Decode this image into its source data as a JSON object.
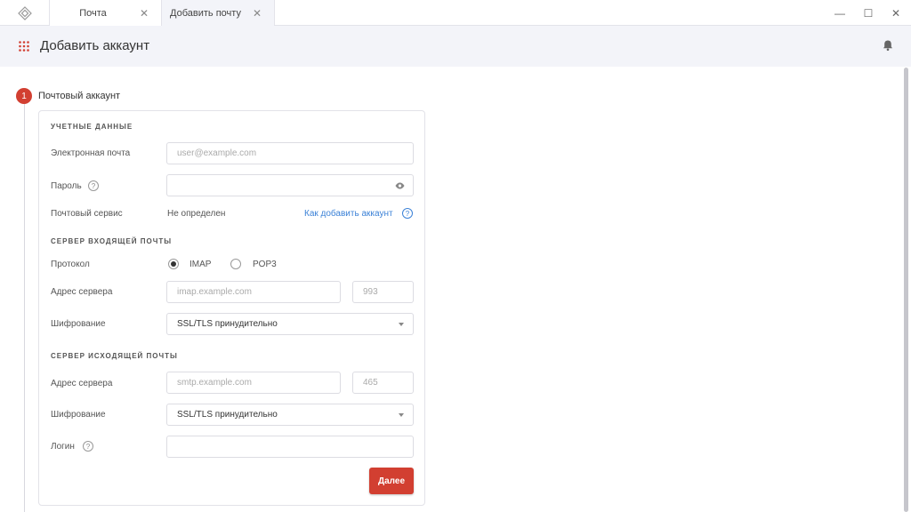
{
  "tabs": [
    {
      "label": "Почта",
      "close": "✕"
    },
    {
      "label": "Добавить почту",
      "close": "✕"
    }
  ],
  "window_controls": {
    "minimize": "—",
    "maximize": "☐",
    "close": "✕"
  },
  "header": {
    "title": "Добавить аккаунт"
  },
  "step": {
    "number": "1",
    "title": "Почтовый аккаунт"
  },
  "credentials": {
    "section_title": "УЧЕТНЫЕ ДАННЫЕ",
    "email_label": "Электронная почта",
    "email_placeholder": "user@example.com",
    "password_label": "Пароль",
    "password_value": "",
    "service_label": "Почтовый сервис",
    "service_value": "Не определен",
    "help_link": "Как добавить аккаунт"
  },
  "incoming": {
    "section_title": "СЕРВЕР ВХОДЯЩЕЙ ПОЧТЫ",
    "protocol_label": "Протокол",
    "protocol_options": [
      "IMAP",
      "POP3"
    ],
    "protocol_selected": "IMAP",
    "server_label": "Адрес сервера",
    "server_placeholder": "imap.example.com",
    "port_placeholder": "993",
    "encryption_label": "Шифрование",
    "encryption_value": "SSL/TLS принудительно"
  },
  "outgoing": {
    "section_title": "СЕРВЕР ИСХОДЯЩЕЙ ПОЧТЫ",
    "server_label": "Адрес сервера",
    "server_placeholder": "smtp.example.com",
    "port_placeholder": "465",
    "encryption_label": "Шифрование",
    "encryption_value": "SSL/TLS принудительно",
    "login_label": "Логин",
    "login_value": ""
  },
  "help_glyph": "?",
  "next_button": "Далее",
  "colors": {
    "accent": "#d23f31",
    "link": "#3c82d7",
    "header_bg": "#f3f4f9"
  }
}
